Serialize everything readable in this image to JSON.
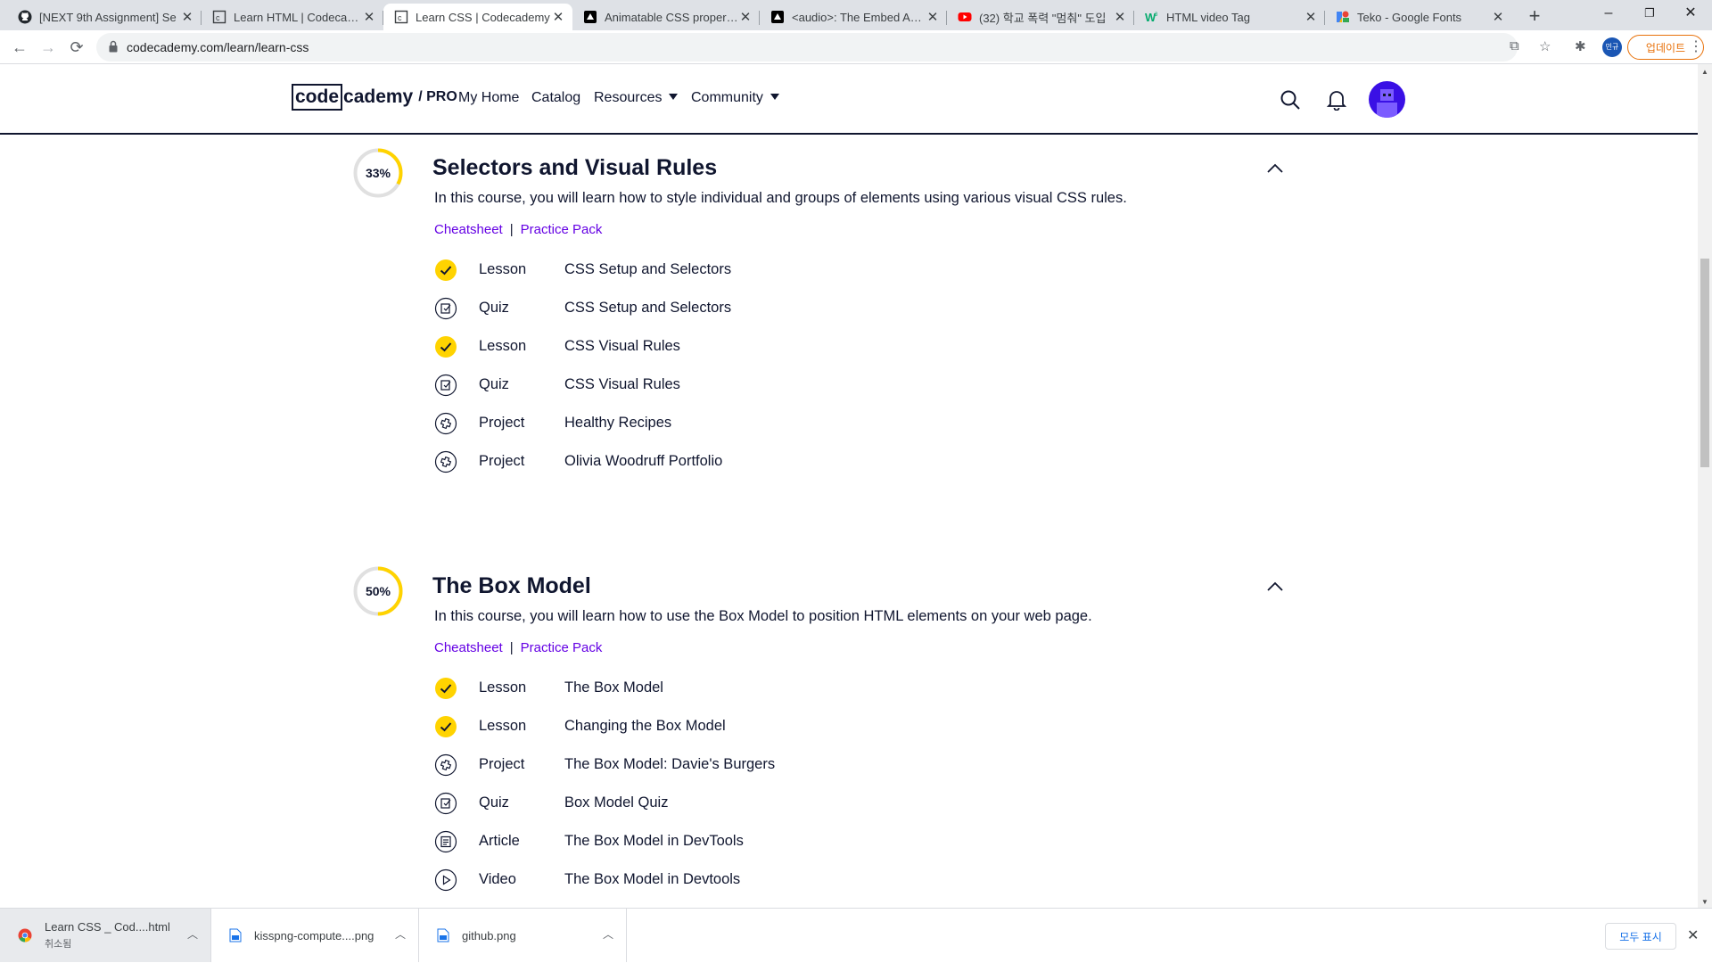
{
  "browser": {
    "tabs": [
      {
        "title": "[NEXT 9th Assignment] Se",
        "icon": "github-icon",
        "active": false
      },
      {
        "title": "Learn HTML | Codecademy",
        "icon": "codecademy-icon",
        "active": false
      },
      {
        "title": "Learn CSS | Codecademy",
        "icon": "codecademy-icon",
        "active": true
      },
      {
        "title": "Animatable CSS properties",
        "icon": "mdn-icon",
        "active": false
      },
      {
        "title": "<audio>: The Embed Audi",
        "icon": "mdn-icon",
        "active": false
      },
      {
        "title": "(32) 학교 폭력 \"멈춰\" 도입",
        "icon": "youtube-icon",
        "active": false
      },
      {
        "title": "HTML video Tag",
        "icon": "w3schools-icon",
        "active": false
      },
      {
        "title": "Teko - Google Fonts",
        "icon": "google-fonts-icon",
        "active": false
      }
    ],
    "url": "codecademy.com/learn/learn-css",
    "profile_label": "민규",
    "update_label": "업데이트"
  },
  "header": {
    "logo_boxed": "code",
    "logo_rest": "cademy",
    "logo_pro": "/ PRO",
    "nav": {
      "my_home": "My Home",
      "catalog": "Catalog",
      "resources": "Resources",
      "community": "Community"
    }
  },
  "courses": [
    {
      "progress_label": "33%",
      "progress": 0.33,
      "title": "Selectors and Visual Rules",
      "description": "In this course, you will learn how to style individual and groups of elements using various visual CSS rules.",
      "cheatsheet": "Cheatsheet",
      "separator": "|",
      "practice_pack": "Practice Pack",
      "items": [
        {
          "kind": "Lesson",
          "name": "CSS Setup and Selectors",
          "status": "complete",
          "icon": "check-icon"
        },
        {
          "kind": "Quiz",
          "name": "CSS Setup and Selectors",
          "status": "incomplete",
          "icon": "quiz-icon"
        },
        {
          "kind": "Lesson",
          "name": "CSS Visual Rules",
          "status": "complete",
          "icon": "check-icon"
        },
        {
          "kind": "Quiz",
          "name": "CSS Visual Rules",
          "status": "incomplete",
          "icon": "quiz-icon"
        },
        {
          "kind": "Project",
          "name": "Healthy Recipes",
          "status": "incomplete",
          "icon": "project-icon"
        },
        {
          "kind": "Project",
          "name": "Olivia Woodruff Portfolio",
          "status": "incomplete",
          "icon": "project-icon"
        }
      ]
    },
    {
      "progress_label": "50%",
      "progress": 0.5,
      "title": "The Box Model",
      "description": "In this course, you will learn how to use the Box Model to position HTML elements on your web page.",
      "cheatsheet": "Cheatsheet",
      "separator": "|",
      "practice_pack": "Practice Pack",
      "items": [
        {
          "kind": "Lesson",
          "name": "The Box Model",
          "status": "complete",
          "icon": "check-icon"
        },
        {
          "kind": "Lesson",
          "name": "Changing the Box Model",
          "status": "complete",
          "icon": "check-icon"
        },
        {
          "kind": "Project",
          "name": "The Box Model: Davie's Burgers",
          "status": "incomplete",
          "icon": "project-icon"
        },
        {
          "kind": "Quiz",
          "name": "Box Model Quiz",
          "status": "incomplete",
          "icon": "quiz-icon"
        },
        {
          "kind": "Article",
          "name": "The Box Model in DevTools",
          "status": "incomplete",
          "icon": "article-icon"
        },
        {
          "kind": "Video",
          "name": "The Box Model in Devtools",
          "status": "incomplete",
          "icon": "video-icon"
        }
      ]
    }
  ],
  "downloads": [
    {
      "name": "Learn CSS _ Cod....html",
      "sub": "취소됨",
      "icon": "chrome-icon"
    },
    {
      "name": "kisspng-compute....png",
      "sub": "",
      "icon": "image-file-icon"
    },
    {
      "name": "github.png",
      "sub": "",
      "icon": "image-file-icon"
    }
  ],
  "show_all_label": "모두 표시",
  "colors": {
    "accent_yellow": "#ffd300",
    "link_purple": "#6400e4",
    "navy": "#10162f",
    "ring_track": "#e0e0e0",
    "avatar": "#3a10e5"
  }
}
